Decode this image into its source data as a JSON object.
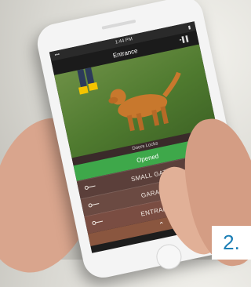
{
  "screen": {
    "status_time": "1:44 PM",
    "title": "Entrance",
    "signal": "‣▌▌",
    "caption": "Doors Locks",
    "opened_label": "Opened",
    "items": [
      {
        "label": "SMALL GATE"
      },
      {
        "label": "GARAGE"
      },
      {
        "label": "ENTRANCE"
      }
    ],
    "chevron": "⌃"
  },
  "corner_label": "2.",
  "colors": {
    "opened": "#3ea84a",
    "accent_number": "#1c7fb6"
  }
}
